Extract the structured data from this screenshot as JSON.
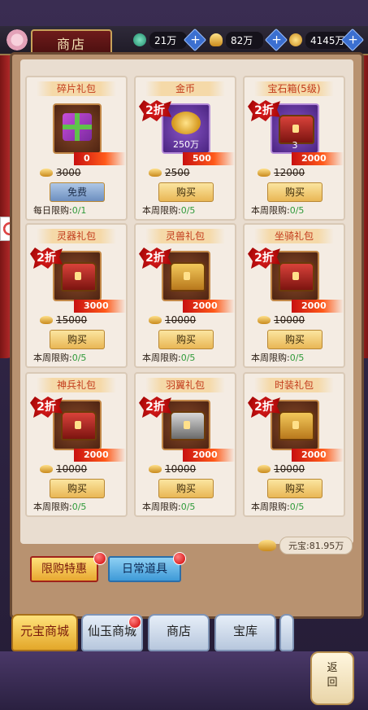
{
  "header": {
    "title": "商店",
    "resources": [
      {
        "icon": "jade-icon",
        "value": "21万"
      },
      {
        "icon": "gold-ingot-icon",
        "value": "82万"
      },
      {
        "icon": "coin-icon",
        "value": "4145万"
      }
    ]
  },
  "cards": [
    {
      "name": "碎片礼包",
      "discount": "",
      "new_price": "0",
      "old_price": "3000",
      "button": "免费",
      "limit_label": "每日限购:",
      "limit_value": "0/1",
      "qty": "",
      "icon": "gift-icon"
    },
    {
      "name": "金币",
      "discount": "2折",
      "new_price": "500",
      "old_price": "2500",
      "button": "购买",
      "limit_label": "本周限购:",
      "limit_value": "0/5",
      "qty": "250万",
      "icon": "gold-coins-icon"
    },
    {
      "name": "宝石箱(5级)",
      "discount": "2折",
      "new_price": "2000",
      "old_price": "12000",
      "button": "购买",
      "limit_label": "本周限购:",
      "limit_value": "0/5",
      "qty": "3",
      "icon": "gem-chest-icon"
    },
    {
      "name": "灵器礼包",
      "discount": "2折",
      "new_price": "3000",
      "old_price": "15000",
      "button": "购买",
      "limit_label": "本周限购:",
      "limit_value": "0/5",
      "qty": "",
      "icon": "artifact-chest-icon"
    },
    {
      "name": "灵兽礼包",
      "discount": "2折",
      "new_price": "2000",
      "old_price": "10000",
      "button": "购买",
      "limit_label": "本周限购:",
      "limit_value": "0/5",
      "qty": "",
      "icon": "beast-chest-icon"
    },
    {
      "name": "坐骑礼包",
      "discount": "2折",
      "new_price": "2000",
      "old_price": "10000",
      "button": "购买",
      "limit_label": "本周限购:",
      "limit_value": "0/5",
      "qty": "",
      "icon": "mount-chest-icon"
    },
    {
      "name": "神兵礼包",
      "discount": "2折",
      "new_price": "2000",
      "old_price": "10000",
      "button": "购买",
      "limit_label": "本周限购:",
      "limit_value": "0/5",
      "qty": "",
      "icon": "weapon-chest-icon"
    },
    {
      "name": "羽翼礼包",
      "discount": "2折",
      "new_price": "2000",
      "old_price": "10000",
      "button": "购买",
      "limit_label": "本周限购:",
      "limit_value": "0/5",
      "qty": "",
      "icon": "wing-chest-icon"
    },
    {
      "name": "时装礼包",
      "discount": "2折",
      "new_price": "2000",
      "old_price": "10000",
      "button": "购买",
      "limit_label": "本周限购:",
      "limit_value": "0/5",
      "qty": "",
      "icon": "fashion-chest-icon"
    }
  ],
  "balance": {
    "label": "元宝:81.95万",
    "icon": "gold-ingot-icon"
  },
  "sub_tabs": {
    "limited": "限购特惠",
    "daily": "日常道具"
  },
  "bottom_nav": [
    "元宝商城",
    "仙玉商城",
    "商店",
    "宝库"
  ],
  "back": {
    "line1": "返",
    "line2": "回"
  }
}
